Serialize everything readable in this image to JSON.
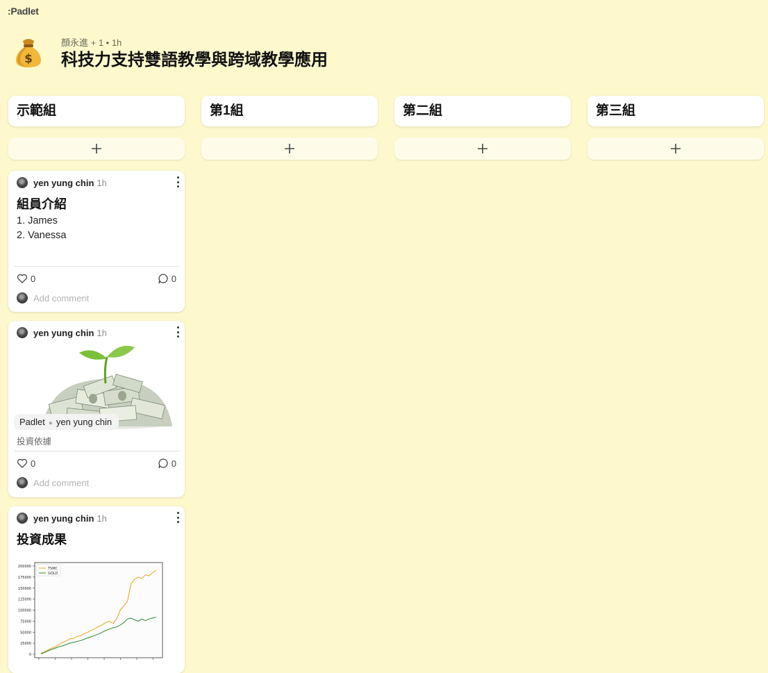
{
  "app": {
    "logo": ":Padlet"
  },
  "board": {
    "icon": "money-bag-icon",
    "meta": "顏永進 + 1 • 1h",
    "title": "科技力支持雙語教學與跨域教學應用"
  },
  "columns": [
    {
      "title": "示範組"
    },
    {
      "title": "第1組"
    },
    {
      "title": "第二組"
    },
    {
      "title": "第三組"
    }
  ],
  "posts": [
    {
      "author": "yen yung chin",
      "time": "1h",
      "title": "組員介紹",
      "body": [
        "1. James",
        "2. Vanessa"
      ],
      "likes": "0",
      "comments": "0",
      "comment_placeholder": "Add comment"
    },
    {
      "author": "yen yung chin",
      "time": "1h",
      "attachment": {
        "source": "Padlet",
        "by": "yen yung chin",
        "image": "plant-growing-from-money-image"
      },
      "caption": "投資依據",
      "likes": "0",
      "comments": "0",
      "comment_placeholder": "Add comment"
    },
    {
      "author": "yen yung chin",
      "time": "1h",
      "title": "投資成果"
    }
  ],
  "chart_data": {
    "type": "line",
    "ylim": [
      0,
      200000
    ],
    "y_ticks": [
      "200000",
      "175000",
      "150000",
      "125000",
      "100000",
      "75000",
      "50000",
      "25000",
      "0"
    ],
    "legend_placement": "top-left",
    "series": [
      {
        "name": "TSMC",
        "color": "#e8a317",
        "values": [
          2000,
          6000,
          10000,
          14000,
          17000,
          22000,
          27000,
          30000,
          35000,
          36000,
          40000,
          42000,
          47000,
          50000,
          54000,
          58000,
          63000,
          67000,
          72000,
          75000,
          70000,
          80000,
          100000,
          110000,
          120000,
          160000,
          170000,
          175000,
          172000,
          180000,
          178000,
          185000,
          190000
        ]
      },
      {
        "name": "GOLD",
        "color": "#2a8a2a",
        "values": [
          1000,
          4000,
          8000,
          11000,
          14000,
          17000,
          19000,
          22000,
          25000,
          27000,
          29000,
          31000,
          34000,
          37000,
          40000,
          43000,
          46000,
          50000,
          54000,
          57000,
          60000,
          62000,
          66000,
          72000,
          80000,
          82000,
          78000,
          75000,
          80000,
          76000,
          80000,
          82000,
          84000
        ]
      }
    ]
  }
}
